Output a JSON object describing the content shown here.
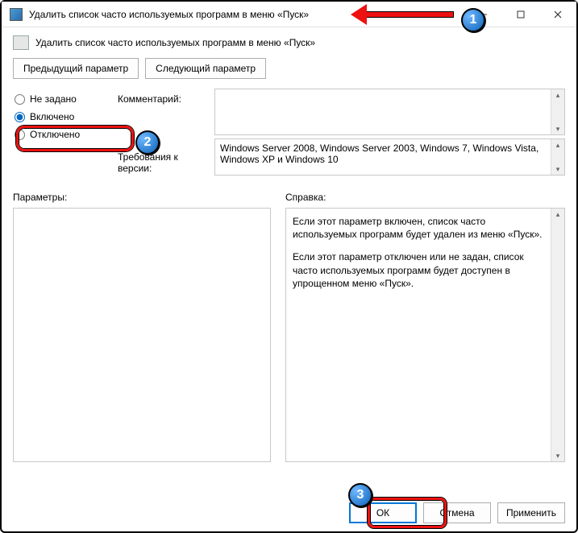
{
  "title": "Удалить список часто используемых программ в меню «Пуск»",
  "header": "Удалить список часто используемых программ в меню «Пуск»",
  "nav": {
    "prev": "Предыдущий параметр",
    "next": "Следующий параметр"
  },
  "radios": {
    "not_configured": "Не задано",
    "enabled": "Включено",
    "disabled": "Отключено"
  },
  "labels": {
    "comment": "Комментарий:",
    "requirements": "Требования к версии:",
    "params": "Параметры:",
    "help": "Справка:"
  },
  "requirements_text": "Windows Server 2008, Windows Server 2003, Windows 7, Windows Vista, Windows XP и Windows 10",
  "help": {
    "p1": "Если этот параметр включен, список часто используемых программ будет удален из меню «Пуск».",
    "p2": "Если этот параметр отключен или не задан, список часто используемых программ будет доступен в упрощенном меню «Пуск»."
  },
  "footer": {
    "ok": "ОК",
    "cancel": "Отмена",
    "apply": "Применить"
  },
  "badges": {
    "b1": "1",
    "b2": "2",
    "b3": "3"
  }
}
